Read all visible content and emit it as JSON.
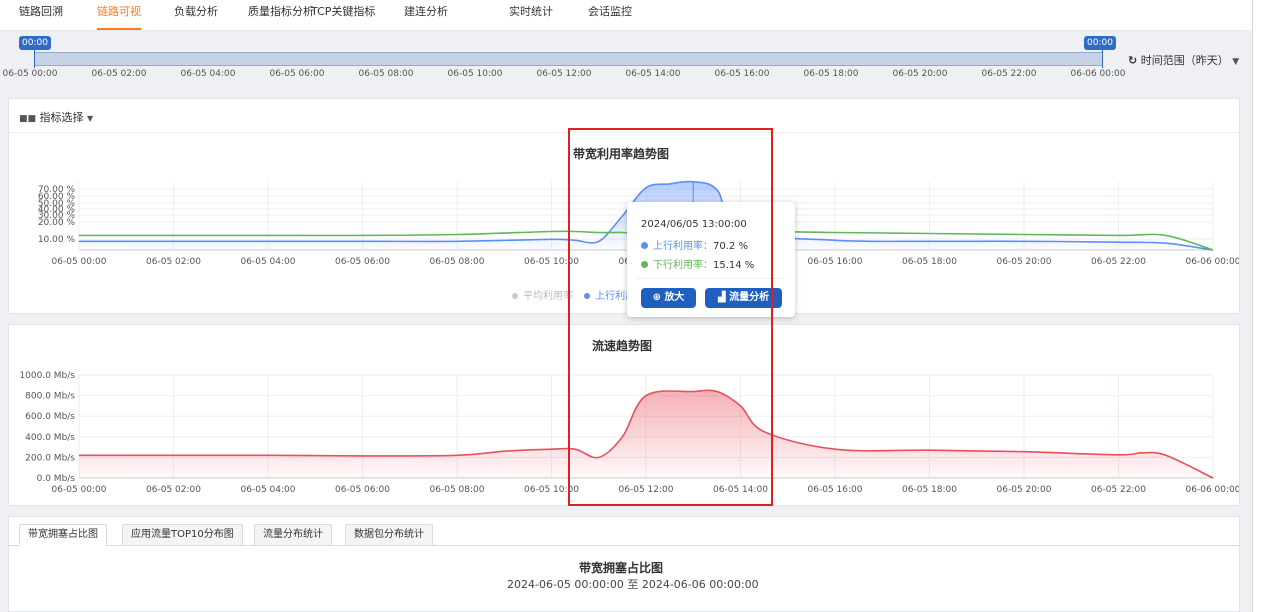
{
  "nav": {
    "tabs": [
      {
        "label": "链路回溯",
        "active": false
      },
      {
        "label": "链路可视",
        "active": true
      },
      {
        "label": "负载分析",
        "active": false
      },
      {
        "label": "质量指标分析",
        "active": false
      },
      {
        "label": "TCP关键指标",
        "active": false
      },
      {
        "label": "建连分析",
        "active": false
      },
      {
        "label": "实时统计",
        "active": false
      },
      {
        "label": "会话监控",
        "active": false
      }
    ]
  },
  "timeline": {
    "start_handle": "00:00",
    "end_handle": "00:00",
    "ticks": [
      "06-05 00:00",
      "06-05 02:00",
      "06-05 04:00",
      "06-05 06:00",
      "06-05 08:00",
      "06-05 10:00",
      "06-05 12:00",
      "06-05 14:00",
      "06-05 16:00",
      "06-05 18:00",
      "06-05 20:00",
      "06-05 22:00",
      "06-06 00:00"
    ],
    "range_label": "时间范围（昨天）",
    "range_icon": "history-icon"
  },
  "metric_select": {
    "label": "指标选择",
    "icon": "grid-icon"
  },
  "bandwidth_chart": {
    "title": "带宽利用率趋势图",
    "y_ticks": [
      "70.00 %",
      "60.00 %",
      "50.00 %",
      "40.00 %",
      "30.00 %",
      "20.00 %",
      "10.00 %"
    ],
    "x_ticks": [
      "06-05 00:00",
      "06-05 02:00",
      "06-05 04:00",
      "06-05 06:00",
      "06-05 08:00",
      "06-05 10:00",
      "06-05 12:00",
      "06-05 14:00",
      "06-05 16:00",
      "06-05 18:00",
      "06-05 20:00",
      "06-05 22:00",
      "06-06 00:00"
    ],
    "legend": [
      {
        "name": "平均利用率",
        "color": "#cccccc"
      },
      {
        "name": "上行利用率",
        "color": "#5b8ff9"
      }
    ]
  },
  "tooltip": {
    "time": "2024/06/05 13:00:00",
    "rows": [
      {
        "label": "上行利用率",
        "value": "70.2 %",
        "color": "#5b8ff9"
      },
      {
        "label": "下行利用率",
        "value": "15.14 %",
        "color": "#5fb85a"
      }
    ],
    "zoom_button": "放大",
    "zoom_icon": "zoom-in-icon",
    "flow_button": "流量分析",
    "flow_icon": "bar-chart-icon"
  },
  "flow_chart": {
    "title": "流速趋势图",
    "y_ticks": [
      "1000.0 Mb/s",
      "800.0 Mb/s",
      "600.0 Mb/s",
      "400.0 Mb/s",
      "200.0 Mb/s",
      "0.0 Mb/s"
    ],
    "x_ticks": [
      "06-05 00:00",
      "06-05 02:00",
      "06-05 04:00",
      "06-05 06:00",
      "06-05 08:00",
      "06-05 10:00",
      "06-05 12:00",
      "06-05 14:00",
      "06-05 16:00",
      "06-05 18:00",
      "06-05 20:00",
      "06-05 22:00",
      "06-06 00:00"
    ]
  },
  "bottom_tabs": [
    {
      "label": "带宽拥塞占比图",
      "active": true
    },
    {
      "label": "应用流量TOP10分布图",
      "active": false
    },
    {
      "label": "流量分布统计",
      "active": false
    },
    {
      "label": "数据包分布统计",
      "active": false
    }
  ],
  "congestion": {
    "title": "带宽拥塞占比图",
    "subtitle": "2024-06-05 00:00:00 至 2024-06-06 00:00:00"
  },
  "chart_data": [
    {
      "type": "line",
      "title": "带宽利用率趋势图",
      "x": [
        "06-05 00:00",
        "06-05 02:00",
        "06-05 04:00",
        "06-05 06:00",
        "06-05 08:00",
        "06-05 10:00",
        "06-05 10:30",
        "06-05 11:00",
        "06-05 11:30",
        "06-05 12:00",
        "06-05 12:30",
        "06-05 13:00",
        "06-05 13:30",
        "06-05 14:00",
        "06-05 16:00",
        "06-05 18:00",
        "06-05 20:00",
        "06-05 22:00",
        "06-05 23:00",
        "06-06 00:00"
      ],
      "series": [
        {
          "name": "上行利用率",
          "color": "#5b8ff9",
          "values": [
            9,
            9,
            9,
            9,
            9,
            11,
            10,
            9,
            35,
            64,
            68,
            70.2,
            62,
            20,
            10,
            9,
            9,
            8,
            7,
            0
          ]
        },
        {
          "name": "下行利用率",
          "color": "#5fb85a",
          "values": [
            15,
            15,
            15,
            15,
            16,
            19,
            19,
            18,
            18,
            17,
            16,
            15.14,
            15,
            19,
            18,
            17,
            16,
            15,
            15,
            0
          ]
        }
      ],
      "ylim": [
        0,
        70
      ],
      "y_unit": "%"
    },
    {
      "type": "area",
      "title": "流速趋势图",
      "x": [
        "06-05 00:00",
        "06-05 02:00",
        "06-05 04:00",
        "06-05 06:00",
        "06-05 08:00",
        "06-05 09:00",
        "06-05 10:00",
        "06-05 10:30",
        "06-05 11:00",
        "06-05 11:30",
        "06-05 12:00",
        "06-05 13:00",
        "06-05 13:30",
        "06-05 14:00",
        "06-05 14:30",
        "06-05 16:00",
        "06-05 18:00",
        "06-05 20:00",
        "06-05 22:00",
        "06-05 22:30",
        "06-05 23:00",
        "06-06 00:00"
      ],
      "series": [
        {
          "name": "流速",
          "color": "#e8505b",
          "values": [
            220,
            220,
            220,
            215,
            220,
            260,
            280,
            280,
            200,
            400,
            800,
            840,
            840,
            700,
            450,
            280,
            270,
            255,
            225,
            245,
            220,
            0
          ]
        }
      ],
      "ylim": [
        0,
        1000
      ],
      "y_unit": "Mb/s"
    }
  ]
}
